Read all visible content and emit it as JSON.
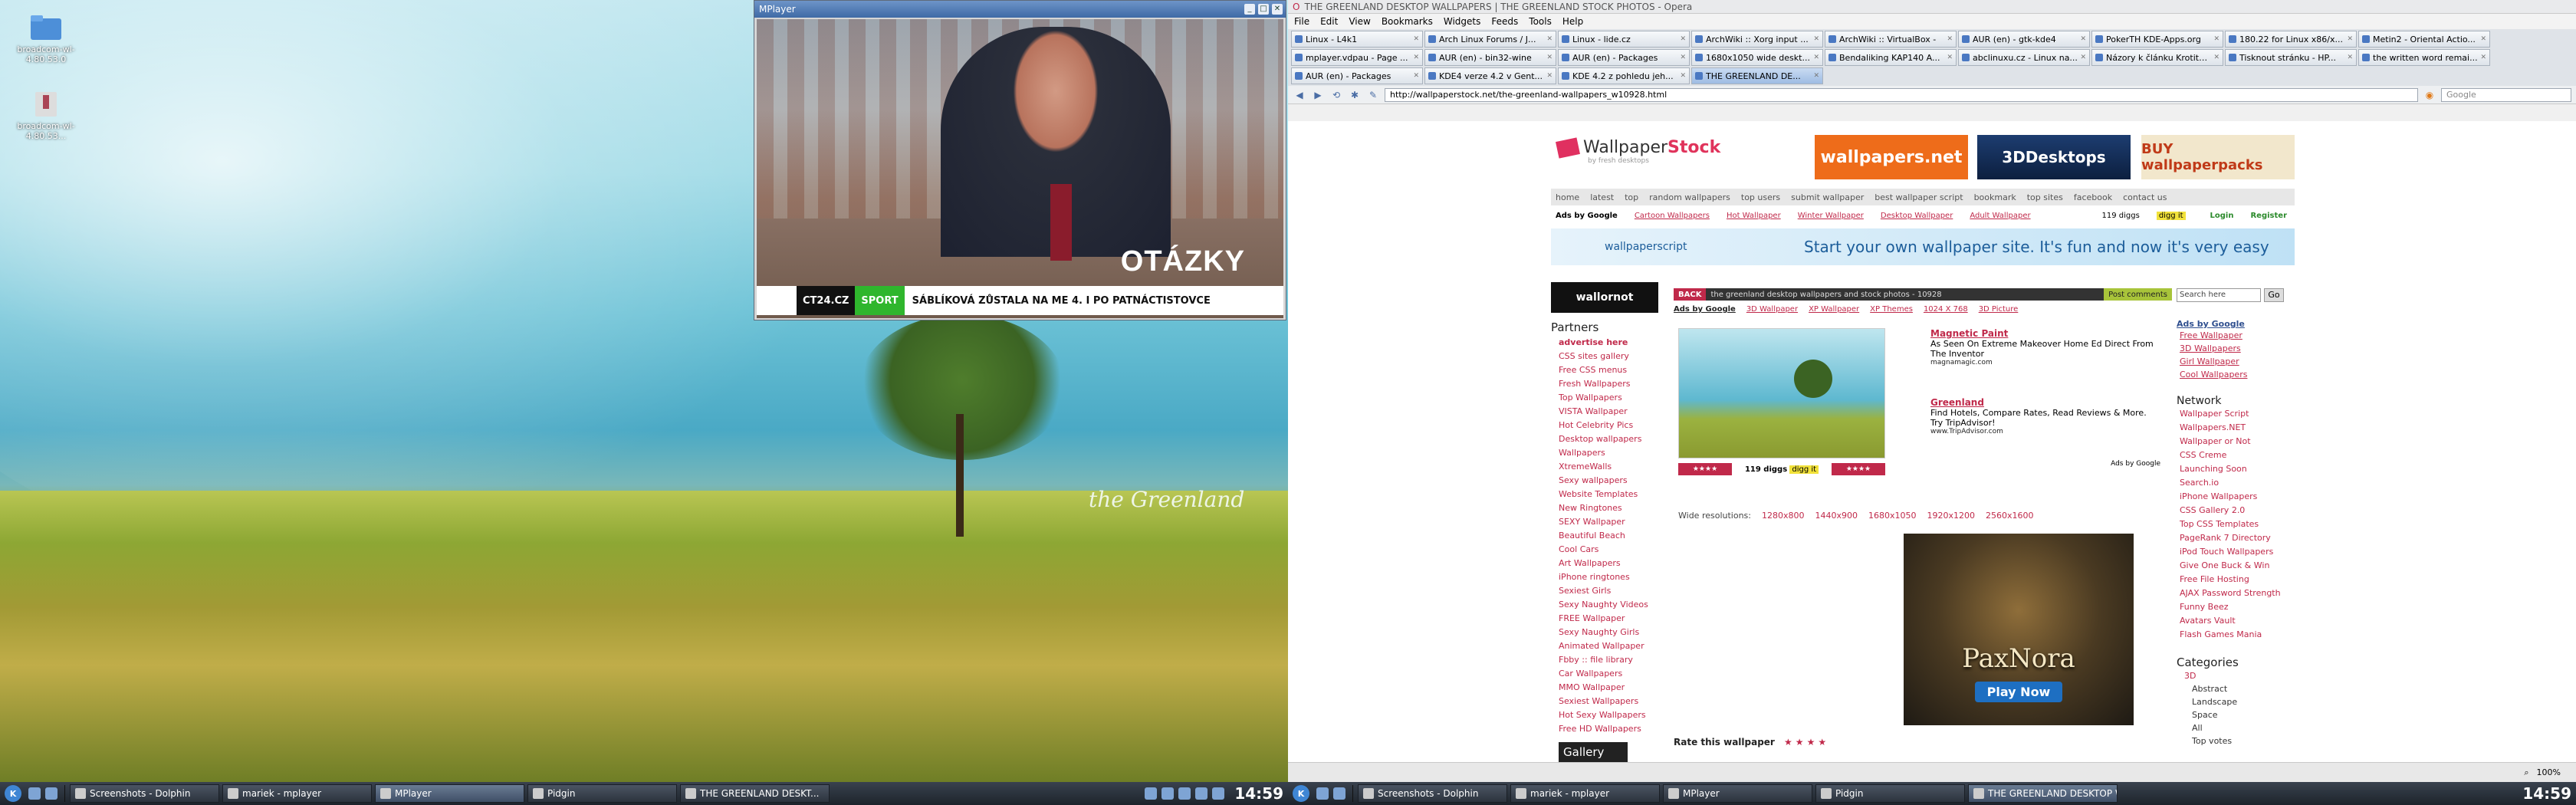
{
  "desktop": {
    "icons": [
      {
        "label": "broadcom-wl-4.80.53.0"
      },
      {
        "label": "broadcom-wl-4.80.53..."
      }
    ],
    "wallpaper_text": "the Greenland"
  },
  "mplayer": {
    "title": "MPlayer",
    "buttons": [
      "_",
      "□",
      "✕"
    ],
    "overlay": "OTÁZKY",
    "ticker": {
      "channel": "CT24.CZ",
      "tag": "SPORT",
      "text": "SÁBLÍKOVÁ ZŮSTALA NA ME 4. I PO PATNÁCTISTOVCE"
    }
  },
  "opera": {
    "title": "THE GREENLAND DESKTOP WALLPAPERS | THE GREENLAND STOCK PHOTOS - Opera",
    "menu": [
      "File",
      "Edit",
      "View",
      "Bookmarks",
      "Widgets",
      "Feeds",
      "Tools",
      "Help"
    ],
    "tabs": [
      "Linux - L4k1",
      "Arch Linux Forums / J...",
      "Linux - lide.cz",
      "ArchWiki :: Xorg input ...",
      "ArchWiki :: VirtualBox -",
      "AUR (en) - gtk-kde4",
      "PokerTH KDE-Apps.org",
      "180.22 for Linux x86/x...",
      "Metin2 - Oriental Actio...",
      "mplayer.vdpau - Page ...",
      "AUR (en) - bin32-wine",
      "AUR (en) - Packages",
      "1680x1050 wide deskt...",
      "Bendaliking KAP140 A...",
      "abclinuxu.cz - Linux na...",
      "Názory k článku Krotite...",
      "Tisknout stránku - HP...",
      "the written word remai...",
      "AUR (en) - Packages",
      "KDE4 verze 4.2 v Gent...",
      "KDE 4.2 z pohledu jeh...",
      "THE GREENLAND DE..."
    ],
    "active_tab": 21,
    "nav": [
      "◀",
      "▶",
      "⟲",
      "✱",
      "✎"
    ],
    "url": "http://wallpaperstock.net/the-greenland-wallpapers_w10928.html",
    "search_placeholder": "Google",
    "status": [
      "100%"
    ]
  },
  "site": {
    "logo_main": "Wallpaper",
    "logo_accent": "Stock",
    "logo_tag": "by fresh desktops",
    "banners": [
      "wallpapers.net",
      "3DDesktops",
      "BUY wallpaperpacks"
    ],
    "nav": [
      "home",
      "latest",
      "top",
      "random wallpapers",
      "top users",
      "submit wallpaper",
      "best wallpaper script",
      "bookmark",
      "top sites",
      "facebook",
      "contact us"
    ],
    "sub": {
      "ads": "Ads by Google",
      "links": [
        "Cartoon Wallpapers",
        "Hot Wallpaper",
        "Winter Wallpaper",
        "Desktop Wallpaper",
        "Adult Wallpaper"
      ],
      "diggs": "119 diggs",
      "digg": "digg it",
      "login": "Login",
      "register": "Register"
    },
    "promo": {
      "logo": "wallpaperscript",
      "text": "Start your own wallpaper site. It's fun and now it's very easy"
    },
    "left": {
      "logo": "wallornot",
      "partners": "Partners",
      "links": [
        "advertise here",
        "CSS sites gallery",
        "Free CSS menus",
        "Fresh Wallpapers",
        "Top Wallpapers",
        "VISTA Wallpaper",
        "Hot Celebrity Pics",
        "Desktop wallpapers",
        "Wallpapers",
        "XtremeWalls",
        "Sexy wallpapers",
        "Website Templates",
        "New Ringtones",
        "SEXY Wallpaper",
        "Beautiful Beach",
        "Cool Cars",
        "Art Wallpapers",
        "iPhone ringtones",
        "Sexiest Girls",
        "Sexy Naughty Videos",
        "FREE Wallpaper",
        "Sexy Naughty Girls",
        "Animated Wallpaper",
        "Fbby :: file library",
        "Car Wallpapers",
        "MMO Wallpaper",
        "Sexiest Wallpapers",
        "Hot Sexy Wallpapers",
        "Free HD Wallpapers"
      ],
      "gallery": "Gallery"
    },
    "mid": {
      "back": "BACK",
      "path": "the greenland desktop wallpapers and stock photos - 10928",
      "post": "Post comments",
      "ads_label": "Ads by Google",
      "ads_links": [
        "3D Wallpaper",
        "XP Wallpaper",
        "XP Themes",
        "1024 X 768",
        "3D Picture"
      ],
      "diggs": "119 diggs",
      "digg": "digg it",
      "ad1": {
        "title": "Magnetic Paint",
        "text": "As Seen On Extreme Makeover Home Ed Direct From The Inventor",
        "url": "magnamagic.com"
      },
      "ad2": {
        "title": "Greenland",
        "text": "Find Hotels, Compare Rates, Read Reviews & More. Try TripAdvisor!",
        "url": "www.TripAdvisor.com"
      },
      "ads_by": "Ads by Google",
      "wide_label": "Wide resolutions:",
      "wide": [
        "1280x800",
        "1440x900",
        "1680x1050",
        "1920x1200",
        "2560x1600"
      ],
      "pax_name": "PaxNora",
      "pax_btn": "Play Now",
      "rate": "Rate this wallpaper",
      "stars": "★★★★"
    },
    "right": {
      "search_value": "Search here",
      "go": "Go",
      "ads": "Ads by Google",
      "ad_links": [
        "Free Wallpaper",
        "3D Wallpapers",
        "Girl Wallpaper",
        "Cool Wallpapers"
      ],
      "network": "Network",
      "net_links": [
        "Wallpaper Script",
        "Wallpapers.NET",
        "Wallpaper or Not",
        "CSS Creme",
        "Launching Soon",
        "Search.io",
        "iPhone Wallpapers",
        "CSS Gallery 2.0",
        "Top CSS Templates",
        "PageRank 7 Directory",
        "iPod Touch Wallpapers",
        "Give One Buck & Win",
        "Free File Hosting",
        "AJAX Password Strength",
        "Funny Beez",
        "Avatars Vault",
        "Flash Games Mania"
      ],
      "categories": "Categories",
      "cats": [
        "3D",
        "Abstract",
        "Landscape",
        "Space",
        "All",
        "Top votes"
      ]
    }
  },
  "taskbar_left": {
    "tasks": [
      "Screenshots - Dolphin",
      "mariek - mplayer",
      "MPlayer",
      "Pidgin",
      "THE GREENLAND DESKT..."
    ],
    "active": 2,
    "clock": "14:59"
  },
  "taskbar_right": {
    "tasks": [
      "Screenshots - Dolphin",
      "mariek - mplayer",
      "MPlayer",
      "Pidgin",
      "THE GREENLAND DESKTOP WAL..."
    ],
    "active": 4,
    "clock": "14:59"
  }
}
